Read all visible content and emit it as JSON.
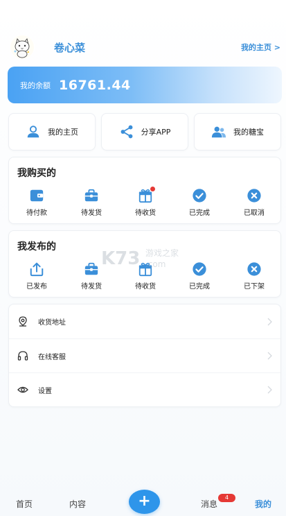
{
  "profile": {
    "username": "卷心菜",
    "home_link": "我的主页 >"
  },
  "balance": {
    "label": "我的余额",
    "value": "16761.44"
  },
  "quick_actions": [
    {
      "label": "我的主页",
      "icon": "user-icon"
    },
    {
      "label": "分享APP",
      "icon": "share-icon"
    },
    {
      "label": "我的糖宝",
      "icon": "users-icon"
    }
  ],
  "purchased": {
    "title": "我购买的",
    "items": [
      {
        "label": "待付款",
        "icon": "wallet-icon"
      },
      {
        "label": "待发货",
        "icon": "box-icon"
      },
      {
        "label": "待收货",
        "icon": "gift-icon",
        "dot": true
      },
      {
        "label": "已完成",
        "icon": "check-circle-icon"
      },
      {
        "label": "已取消",
        "icon": "x-circle-icon"
      }
    ]
  },
  "published": {
    "title": "我发布的",
    "items": [
      {
        "label": "已发布",
        "icon": "upload-icon"
      },
      {
        "label": "待发货",
        "icon": "box-icon"
      },
      {
        "label": "待收货",
        "icon": "gift-icon"
      },
      {
        "label": "已完成",
        "icon": "check-circle-icon"
      },
      {
        "label": "已下架",
        "icon": "x-circle-icon"
      }
    ]
  },
  "menu": [
    {
      "label": "收货地址",
      "icon": "location-icon"
    },
    {
      "label": "在线客服",
      "icon": "headset-icon"
    },
    {
      "label": "设置",
      "icon": "eye-icon"
    }
  ],
  "watermark": {
    "line1": "K73",
    "line2": "游戏之家",
    "line3": ".com"
  },
  "tabbar": {
    "home": "首页",
    "content": "内容",
    "plus": "+",
    "messages": "消息",
    "messages_badge": "4",
    "mine": "我的"
  },
  "colors": {
    "accent": "#3b8fd9",
    "fab": "#2e95ea",
    "badge": "#e53935"
  }
}
